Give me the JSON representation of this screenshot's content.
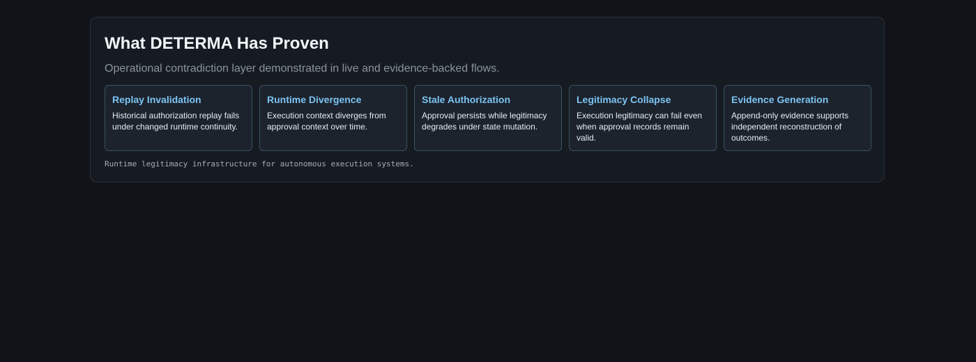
{
  "panel": {
    "title": "What DETERMA Has Proven",
    "subtitle": "Operational contradiction layer demonstrated in live and evidence-backed flows.",
    "footer": "Runtime legitimacy infrastructure for autonomous execution systems."
  },
  "cards": [
    {
      "title": "Replay Invalidation",
      "description": "Historical authorization replay fails under changed runtime continuity."
    },
    {
      "title": "Runtime Divergence",
      "description": "Execution context diverges from approval context over time."
    },
    {
      "title": "Stale Authorization",
      "description": "Approval persists while legitimacy degrades under state mutation."
    },
    {
      "title": "Legitimacy Collapse",
      "description": "Execution legitimacy can fail even when approval records remain valid."
    },
    {
      "title": "Evidence Generation",
      "description": "Append-only evidence supports independent reconstruction of outcomes."
    }
  ],
  "colors": {
    "background": "#111318",
    "panel": "#161b22",
    "card": "#1c232d",
    "card_border": "#3b5162",
    "accent": "#7cc4f2"
  }
}
